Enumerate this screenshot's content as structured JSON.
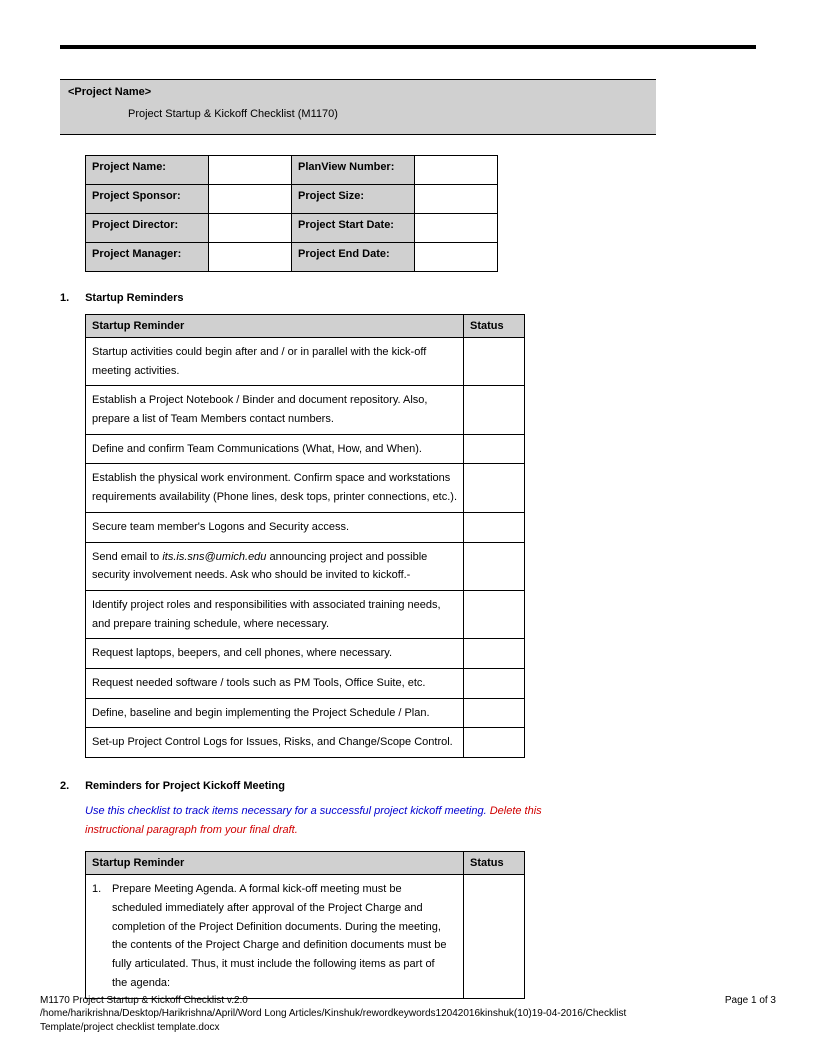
{
  "header": {
    "project_name_placeholder": "<Project Name>",
    "subtitle": "Project Startup & Kickoff Checklist (M1170)"
  },
  "meta_table": {
    "rows": [
      {
        "l1": "Project Name:",
        "l2": "PlanView Number:"
      },
      {
        "l1": "Project Sponsor:",
        "l2": "Project Size:"
      },
      {
        "l1": "Project Director:",
        "l2": "Project Start Date:"
      },
      {
        "l1": "Project Manager:",
        "l2": "Project End Date:"
      }
    ]
  },
  "section1": {
    "number": "1.",
    "title": "Startup Reminders",
    "col_reminder": "Startup Reminder",
    "col_status": "Status",
    "rows": [
      "Startup activities could begin after and / or in parallel with the kick-off meeting activities.",
      "Establish a Project Notebook / Binder and document repository. Also, prepare a list of Team Members contact numbers.",
      "Define and confirm Team Communications (What, How, and When).",
      "Establish the physical work environment. Confirm space and workstations requirements availability (Phone lines, desk tops, printer connections, etc.).",
      "Secure team member's Logons and Security access.",
      "__EMAIL_ROW__",
      "Identify project roles and responsibilities with associated training needs, and prepare training schedule, where necessary.",
      "Request laptops, beepers, and cell phones, where necessary.",
      "Request needed software / tools such as PM Tools, Office Suite, etc.",
      "Define, baseline and begin implementing the Project Schedule / Plan.",
      "Set-up Project Control Logs for Issues, Risks, and Change/Scope Control."
    ],
    "email_pre": "Send email to ",
    "email_addr": "its.is.sns@umich.edu",
    "email_post": " announcing project and possible security involvement needs.  Ask who should be invited to kickoff.-"
  },
  "section2": {
    "number": "2.",
    "title": "Reminders for Project Kickoff Meeting",
    "instruct_blue": "Use this checklist to track items necessary for a successful project kickoff meeting. ",
    "instruct_red": "Delete this instructional paragraph from your final draft.",
    "col_reminder": "Startup Reminder",
    "col_status": "Status",
    "row1_num": "1.",
    "row1_text": "Prepare Meeting Agenda. A formal kick-off meeting must be scheduled immediately after approval of the Project Charge and completion of the Project Definition documents. During the meeting, the contents of the Project Charge and definition documents must be fully articulated. Thus, it must include the following items as part of the agenda:"
  },
  "footer": {
    "line1": "M1170 Project Startup & Kickoff Checklist v.2.0",
    "line2": "/home/harikrishna/Desktop/Harikrishna/April/Word Long Articles/Kinshuk/rewordkeywords12042016kinshuk(10)19-04-2016/Checklist Template/project checklist template.docx",
    "page": "Page 1 of 3"
  }
}
